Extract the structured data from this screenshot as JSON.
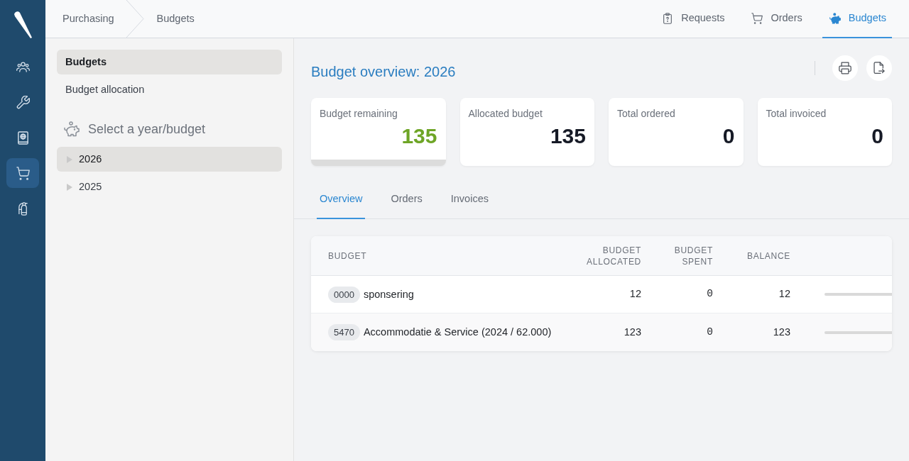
{
  "rail": {
    "items": [
      {
        "selected": false
      },
      {
        "selected": false
      },
      {
        "selected": false
      },
      {
        "selected": true
      },
      {
        "selected": false
      }
    ]
  },
  "breadcrumb": [
    "Purchasing",
    "Budgets"
  ],
  "top_nav": [
    {
      "label": "Requests",
      "selected": false
    },
    {
      "label": "Orders",
      "selected": false
    },
    {
      "label": "Budgets",
      "selected": true
    }
  ],
  "sidebar": {
    "items": [
      {
        "label": "Budgets",
        "selected": true
      },
      {
        "label": "Budget allocation",
        "selected": false
      }
    ],
    "heading": "Select a year/budget",
    "tree": [
      {
        "label": "2026",
        "selected": true,
        "expanded": false
      },
      {
        "label": "2025",
        "selected": false,
        "expanded": false
      }
    ]
  },
  "main": {
    "title": "Budget overview: 2026",
    "stats": [
      {
        "label": "Budget remaining",
        "value": "135",
        "color": "#6ea526",
        "selected": true
      },
      {
        "label": "Allocated budget",
        "value": "135",
        "color": "#161a26",
        "selected": false
      },
      {
        "label": "Total ordered",
        "value": "0",
        "color": "#161a26",
        "selected": false
      },
      {
        "label": "Total invoiced",
        "value": "0",
        "color": "#161a26",
        "selected": false
      }
    ],
    "tabs": [
      {
        "label": "Overview",
        "selected": true
      },
      {
        "label": "Orders",
        "selected": false
      },
      {
        "label": "Invoices",
        "selected": false
      }
    ],
    "table": {
      "columns": [
        "BUDGET",
        "BUDGET ALLOCATED",
        "BUDGET SPENT",
        "BALANCE"
      ],
      "rows": [
        {
          "code": "0000",
          "name": "sponsering",
          "allocated": "12",
          "spent": "0",
          "balance": "12",
          "level": 0
        },
        {
          "code": "5470",
          "name": "Accommodatie & Service (2024 / 62.000)",
          "allocated": "123",
          "spent": "0",
          "balance": "123",
          "level": 0
        }
      ]
    }
  }
}
